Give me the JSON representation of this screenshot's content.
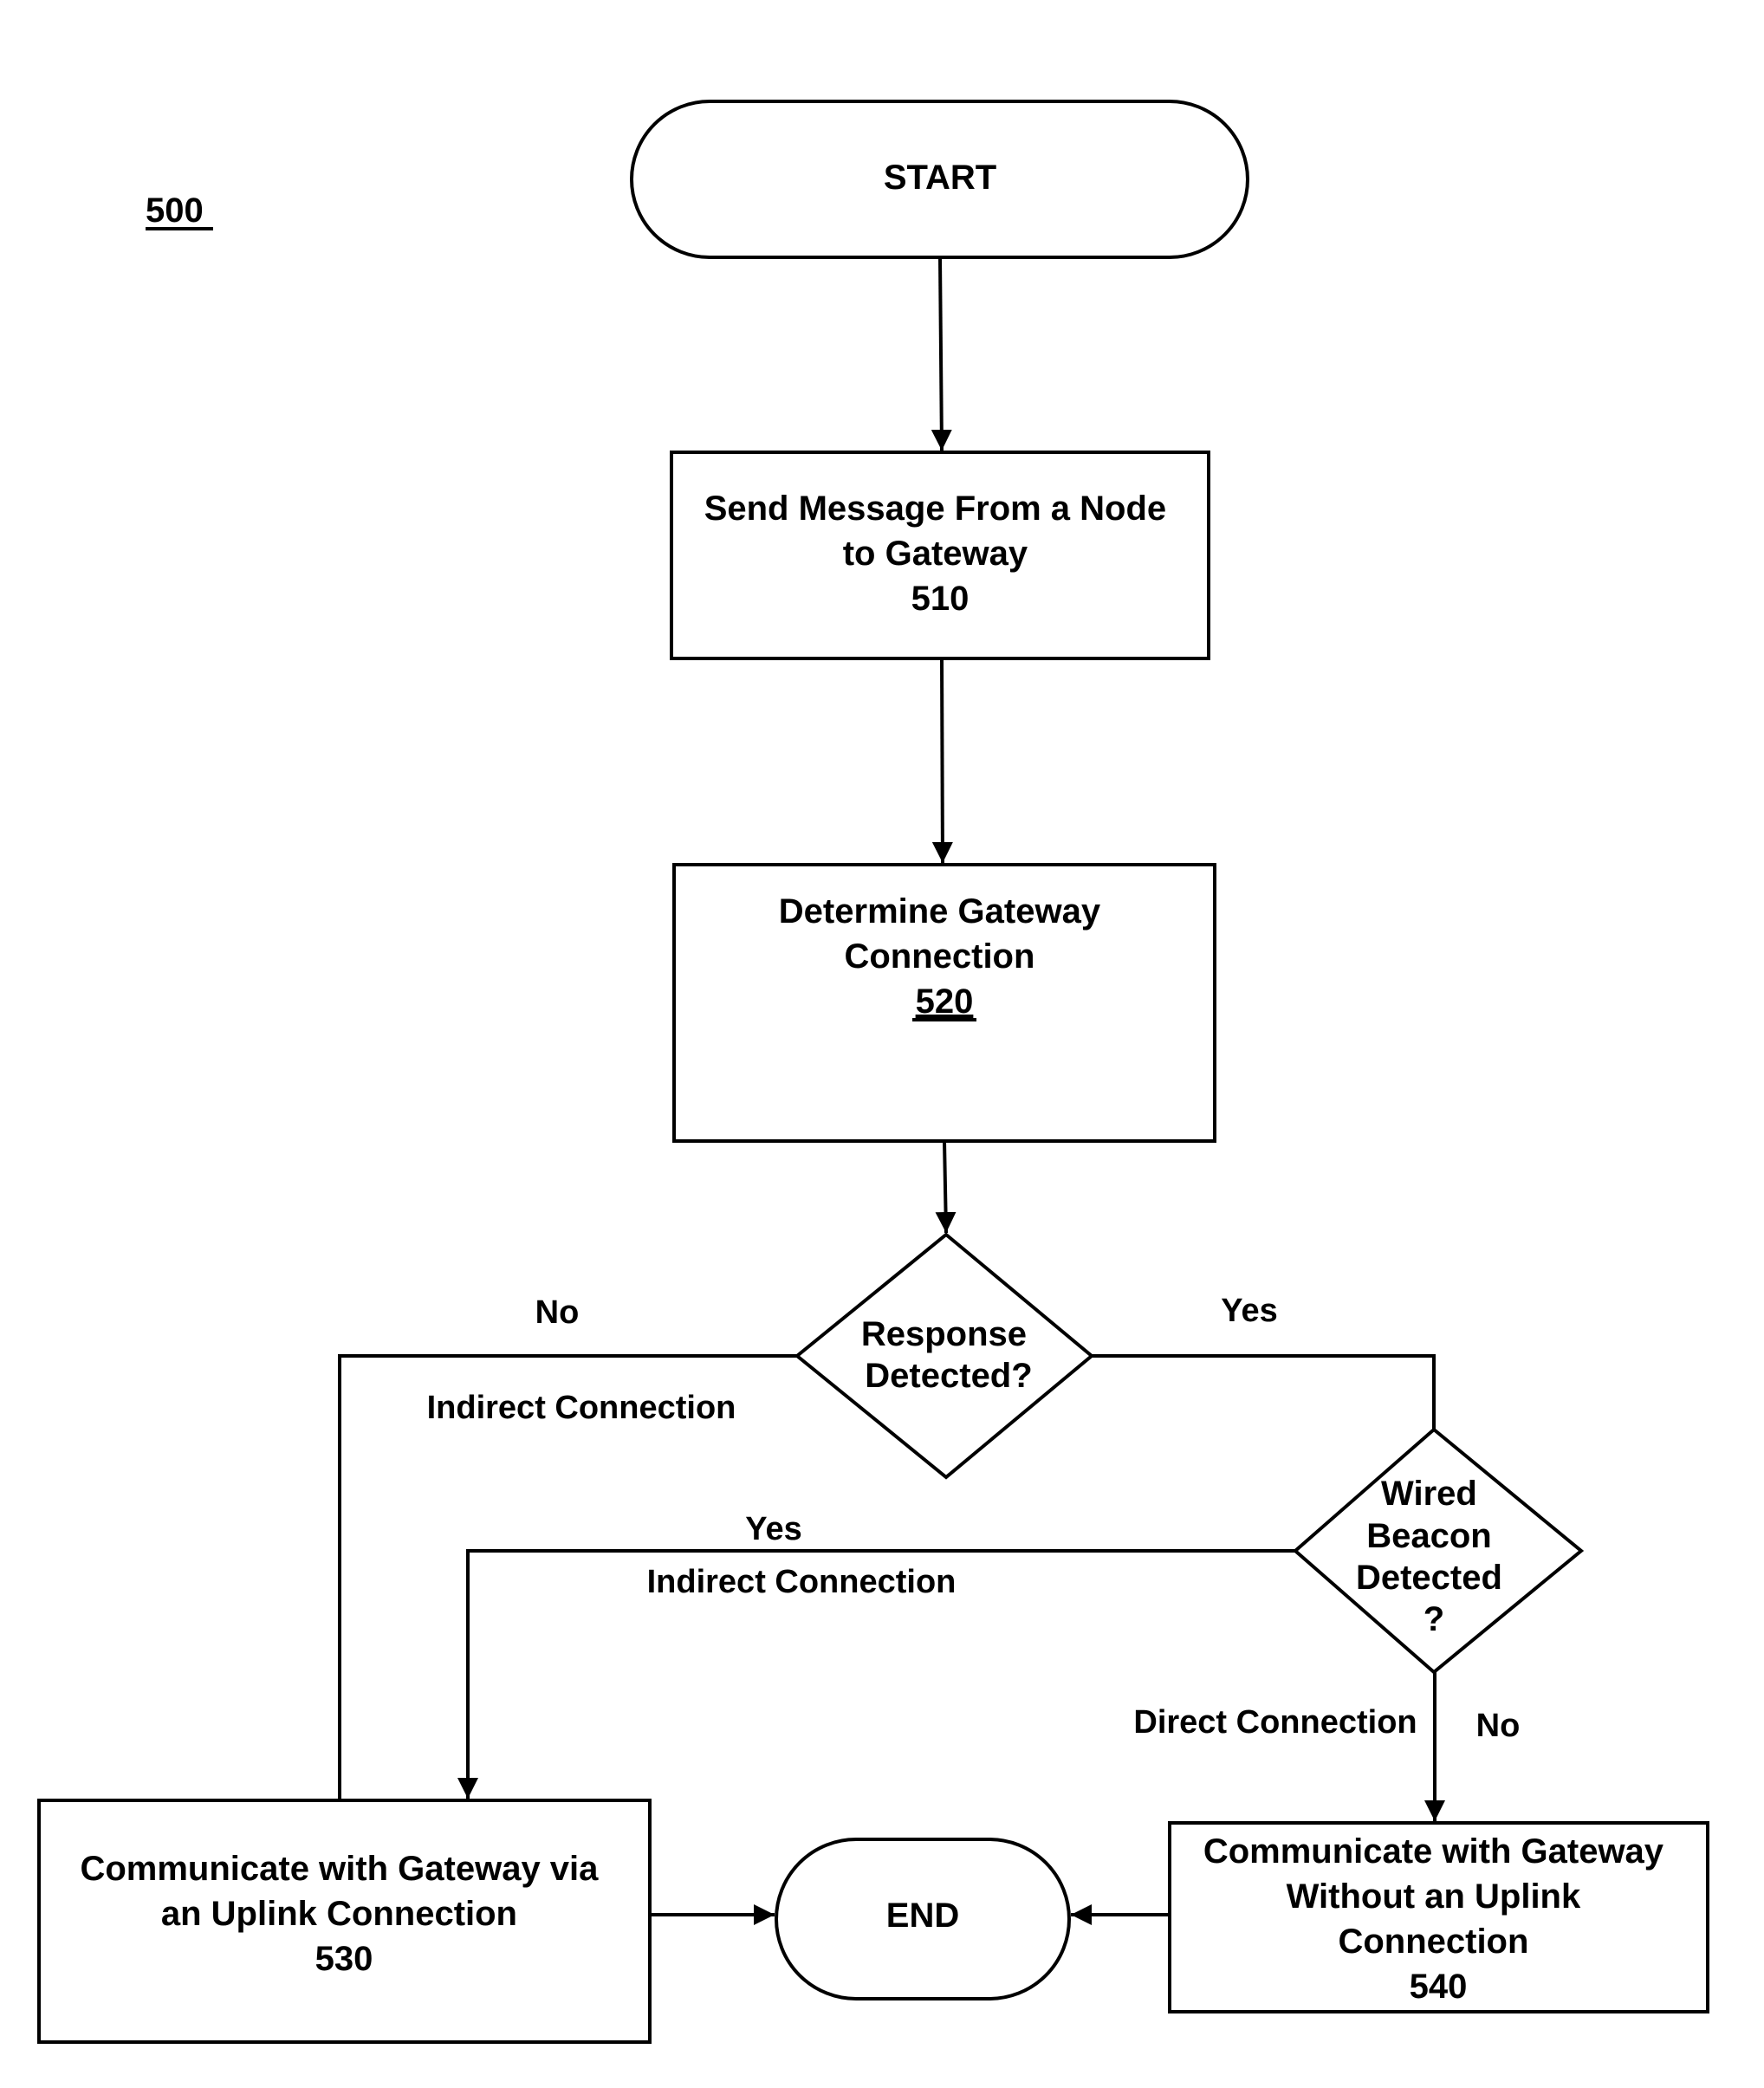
{
  "figure": {
    "reference_number": "500"
  },
  "nodes": {
    "start": {
      "type": "terminal",
      "text": "START"
    },
    "step_510": {
      "type": "process",
      "lines": [
        "Send Message From a Node",
        "to Gateway"
      ],
      "ref": "510",
      "ref_underlined": false
    },
    "step_520": {
      "type": "process",
      "lines": [
        "Determine Gateway",
        "Connection"
      ],
      "ref": "520",
      "ref_underlined": true
    },
    "decision_response": {
      "type": "decision",
      "lines": [
        "Response",
        "Detected?"
      ]
    },
    "decision_wired": {
      "type": "decision",
      "lines": [
        "Wired",
        "Beacon",
        "Detected",
        "?"
      ]
    },
    "step_530": {
      "type": "process",
      "lines": [
        "Communicate with Gateway via",
        "an Uplink Connection"
      ],
      "ref": "530",
      "ref_underlined": false
    },
    "step_540": {
      "type": "process",
      "lines": [
        "Communicate with Gateway",
        "Without an Uplink",
        "Connection"
      ],
      "ref": "540",
      "ref_underlined": false
    },
    "end": {
      "type": "terminal",
      "text": "END"
    }
  },
  "edges": [
    {
      "from": "start",
      "to": "step_510",
      "labels": []
    },
    {
      "from": "step_510",
      "to": "step_520",
      "labels": []
    },
    {
      "from": "step_520",
      "to": "decision_response",
      "labels": []
    },
    {
      "from": "decision_response",
      "to": "step_530",
      "labels": [
        "No",
        "Indirect Connection"
      ]
    },
    {
      "from": "decision_response",
      "to": "decision_wired",
      "labels": [
        "Yes"
      ]
    },
    {
      "from": "decision_wired",
      "to": "step_530",
      "labels": [
        "Yes",
        "Indirect Connection"
      ]
    },
    {
      "from": "decision_wired",
      "to": "step_540",
      "labels": [
        "Direct Connection",
        "No"
      ]
    },
    {
      "from": "step_530",
      "to": "end",
      "labels": []
    },
    {
      "from": "step_540",
      "to": "end",
      "labels": []
    }
  ],
  "edge_labels": {
    "response_no": "No",
    "response_no_desc": "Indirect Connection",
    "response_yes": "Yes",
    "wired_yes": "Yes",
    "wired_yes_desc": "Indirect Connection",
    "wired_no_desc": "Direct Connection",
    "wired_no": "No"
  }
}
